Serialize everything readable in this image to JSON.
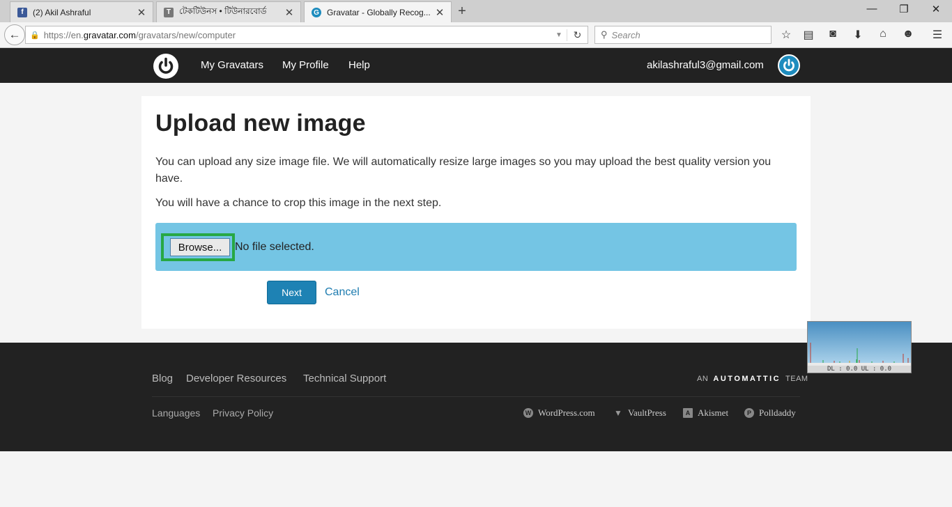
{
  "browser": {
    "tabs": [
      {
        "title": "(2) Akil Ashraful",
        "favicon": "facebook-favicon"
      },
      {
        "title": "টেকটিউনস • টিউনারবোর্ড",
        "favicon": "techtunes-favicon"
      },
      {
        "title": "Gravatar - Globally Recog...",
        "favicon": "gravatar-favicon"
      }
    ],
    "url_prefix": "https://en.",
    "url_domain": "gravatar.com",
    "url_path": "/gravatars/new/computer",
    "search_placeholder": "Search"
  },
  "header": {
    "nav": [
      "My Gravatars",
      "My Profile",
      "Help"
    ],
    "email": "akilashraful3@gmail.com"
  },
  "main": {
    "title": "Upload new image",
    "description": "You can upload any size image file. We will automatically resize large images so you may upload the best quality version you have.",
    "crop_note": "You will have a chance to crop this image in the next step.",
    "browse_label": "Browse...",
    "file_status": "No file selected.",
    "next_label": "Next",
    "cancel_label": "Cancel"
  },
  "widget": {
    "readout": "DL : 0.0 UL : 0.0"
  },
  "footer": {
    "links_primary": [
      "Blog",
      "Developer Resources",
      "Technical Support"
    ],
    "links_secondary": [
      "Languages",
      "Privacy Policy"
    ],
    "team_prefix": "AN",
    "team_brand": "AUTOMATTIC",
    "team_suffix": "TEAM",
    "partners": [
      "WordPress.com",
      "VaultPress",
      "Akismet",
      "Polldaddy"
    ]
  },
  "colors": {
    "header_bg": "#222222",
    "upload_box": "#74c5e4",
    "next_button": "#1e82b4",
    "highlight": "#27a844",
    "link": "#1e7cb0"
  }
}
